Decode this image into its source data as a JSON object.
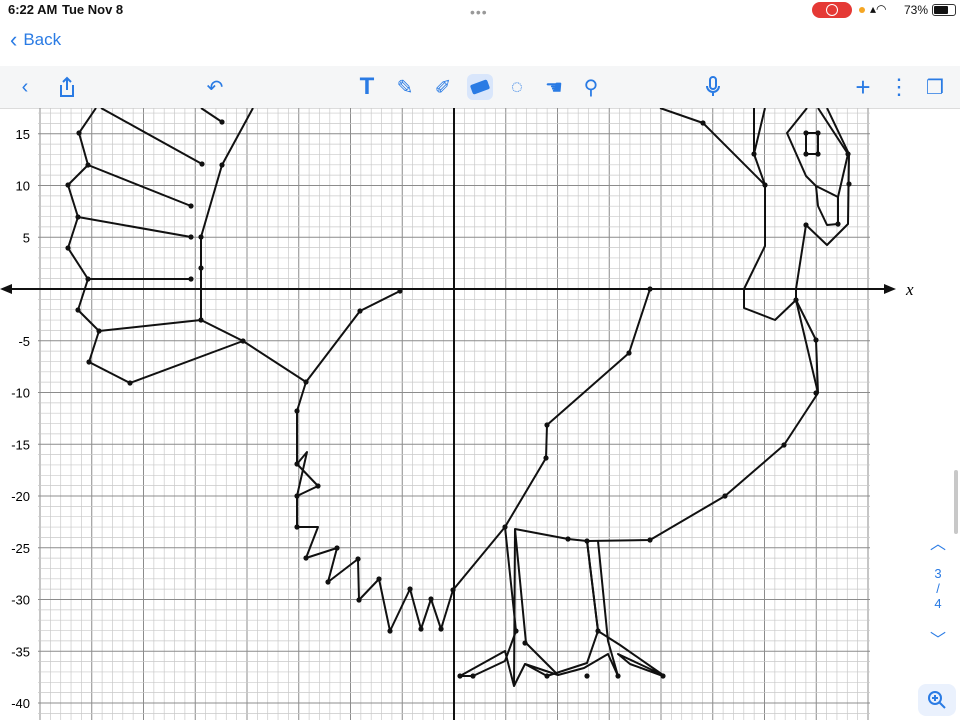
{
  "status": {
    "time": "6:22 AM",
    "date": "Tue Nov 8",
    "battery": "73%"
  },
  "nav": {
    "back_label": "Back"
  },
  "toolbar": {
    "icons": [
      "chevron-left-icon",
      "share-icon",
      "undo-icon",
      "text-tool-icon",
      "pen-icon",
      "highlighter-icon",
      "eraser-icon",
      "lasso-icon",
      "hand-icon",
      "stamp-icon",
      "microphone-icon",
      "add-icon",
      "more-icon",
      "pages-icon"
    ]
  },
  "graph": {
    "x_axis_label": "x",
    "y_ticks": [
      "15",
      "10",
      "5",
      "-5",
      "-10",
      "-15",
      "-20",
      "-25",
      "-30",
      "-35",
      "-40"
    ]
  },
  "page_indicator": {
    "current": "3",
    "sep": "/",
    "total": "4"
  },
  "colors": {
    "accent": "#2a7be4",
    "grid_minor": "#c9c9c9",
    "grid_major": "#8c8c8c",
    "ink": "#111111"
  }
}
